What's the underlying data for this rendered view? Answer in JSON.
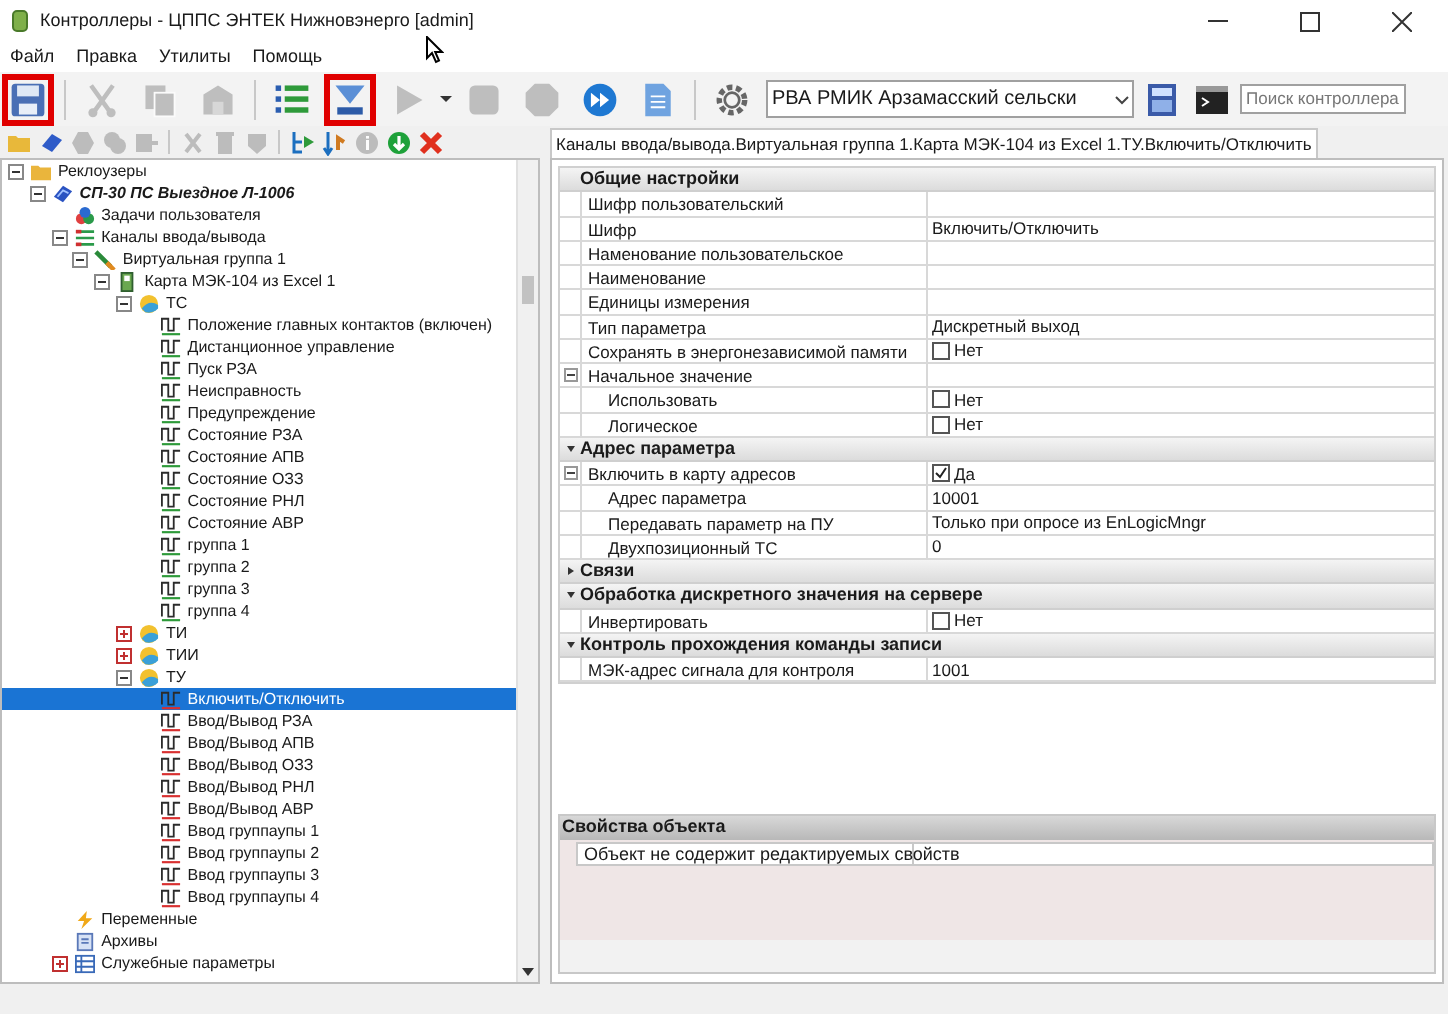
{
  "window": {
    "title": "Контроллеры - ЦППС ЭНТЕК Нижновэнерго [admin]"
  },
  "menu": [
    "Файл",
    "Правка",
    "Утилиты",
    "Помощь"
  ],
  "toolbar": {
    "buttons": [
      {
        "kind": "save",
        "disabled": false,
        "highlighted": true
      },
      {
        "kind": "separator"
      },
      {
        "kind": "cut",
        "disabled": true,
        "highlighted": false
      },
      {
        "kind": "copy",
        "disabled": true,
        "highlighted": false
      },
      {
        "kind": "paste",
        "disabled": true,
        "highlighted": false
      },
      {
        "kind": "separator"
      },
      {
        "kind": "list",
        "disabled": false,
        "highlighted": false
      },
      {
        "kind": "download",
        "disabled": false,
        "highlighted": true
      },
      {
        "kind": "play",
        "disabled": true,
        "highlighted": false
      },
      {
        "kind": "caret"
      },
      {
        "kind": "stop",
        "disabled": true,
        "highlighted": false
      },
      {
        "kind": "blob",
        "disabled": true,
        "highlighted": false
      },
      {
        "kind": "forward",
        "disabled": false,
        "highlighted": false
      },
      {
        "kind": "document",
        "disabled": false,
        "highlighted": false
      },
      {
        "kind": "separator"
      },
      {
        "kind": "gear",
        "disabled": false,
        "highlighted": false
      }
    ],
    "controller_select": {
      "value": "РВА РМИК Арзамасский сельски"
    },
    "extra_buttons": [
      {
        "kind": "calculator"
      },
      {
        "kind": "terminal"
      }
    ],
    "search": {
      "placeholder": "Поиск контроллера"
    }
  },
  "tree_toolbar": [
    {
      "kind": "folder",
      "disabled": false
    },
    {
      "kind": "eraser",
      "disabled": false
    },
    {
      "kind": "hexagon",
      "disabled": true
    },
    {
      "kind": "circles",
      "disabled": true
    },
    {
      "kind": "export",
      "disabled": true
    },
    {
      "kind": "separator"
    },
    {
      "kind": "cut",
      "disabled": true
    },
    {
      "kind": "trash",
      "disabled": true
    },
    {
      "kind": "shield",
      "disabled": true
    },
    {
      "kind": "separator"
    },
    {
      "kind": "tree",
      "disabled": false
    },
    {
      "kind": "sort",
      "disabled": false
    },
    {
      "kind": "info",
      "disabled": true
    },
    {
      "kind": "add",
      "disabled": false
    },
    {
      "kind": "delete",
      "disabled": false
    }
  ],
  "tree": [
    {
      "label": "Реклоузеры",
      "kind": "folder",
      "expanded": true,
      "selected": false,
      "children": [
        {
          "label": "СП-30 ПС Выездное Л-1006",
          "kind": "device",
          "bold": true,
          "expanded": true,
          "selected": false,
          "children": [
            {
              "label": "Задачи пользователя",
              "kind": "tasks",
              "selected": false
            },
            {
              "label": "Каналы ввода/вывода",
              "kind": "channels",
              "expanded": true,
              "selected": false,
              "children": [
                {
                  "label": "Виртуальная группа 1",
                  "kind": "group",
                  "expanded": true,
                  "selected": false,
                  "children": [
                    {
                      "label": "Карта МЭК-104 из Excel 1",
                      "kind": "card",
                      "expanded": true,
                      "selected": false,
                      "children": [
                        {
                          "label": "ТС",
                          "kind": "category",
                          "expanded": true,
                          "selected": false,
                          "children": [
                            {
                              "label": "Положение главных контактов (включен)",
                              "kind": "signal_in",
                              "selected": false
                            },
                            {
                              "label": "Дистанционное управление",
                              "kind": "signal_in",
                              "selected": false
                            },
                            {
                              "label": "Пуск РЗА",
                              "kind": "signal_in",
                              "selected": false
                            },
                            {
                              "label": "Неисправность",
                              "kind": "signal_in",
                              "selected": false
                            },
                            {
                              "label": "Предупреждение",
                              "kind": "signal_in",
                              "selected": false
                            },
                            {
                              "label": "Состояние РЗА",
                              "kind": "signal_in",
                              "selected": false
                            },
                            {
                              "label": "Состояние АПВ",
                              "kind": "signal_in",
                              "selected": false
                            },
                            {
                              "label": "Состояние ОЗЗ",
                              "kind": "signal_in",
                              "selected": false
                            },
                            {
                              "label": "Состояние РНЛ",
                              "kind": "signal_in",
                              "selected": false
                            },
                            {
                              "label": "Состояние АВР",
                              "kind": "signal_in",
                              "selected": false
                            },
                            {
                              "label": "группа 1",
                              "kind": "signal_in",
                              "selected": false
                            },
                            {
                              "label": "группа 2",
                              "kind": "signal_in",
                              "selected": false
                            },
                            {
                              "label": "группа 3",
                              "kind": "signal_in",
                              "selected": false
                            },
                            {
                              "label": "группа 4",
                              "kind": "signal_in",
                              "selected": false
                            }
                          ]
                        },
                        {
                          "label": "ТИ",
                          "kind": "category",
                          "expanded": false,
                          "selected": false
                        },
                        {
                          "label": "ТИИ",
                          "kind": "category",
                          "expanded": false,
                          "selected": false
                        },
                        {
                          "label": "ТУ",
                          "kind": "category",
                          "expanded": true,
                          "selected": false,
                          "children": [
                            {
                              "label": "Включить/Отключить",
                              "kind": "signal_out",
                              "selected": true
                            },
                            {
                              "label": "Ввод/Вывод РЗА",
                              "kind": "signal_out",
                              "selected": false
                            },
                            {
                              "label": "Ввод/Вывод АПВ",
                              "kind": "signal_out",
                              "selected": false
                            },
                            {
                              "label": "Ввод/Вывод ОЗЗ",
                              "kind": "signal_out",
                              "selected": false
                            },
                            {
                              "label": "Ввод/Вывод РНЛ",
                              "kind": "signal_out",
                              "selected": false
                            },
                            {
                              "label": "Ввод/Вывод АВР",
                              "kind": "signal_out",
                              "selected": false
                            },
                            {
                              "label": "Ввод группаупы 1",
                              "kind": "signal_out",
                              "selected": false
                            },
                            {
                              "label": "Ввод группаупы 2",
                              "kind": "signal_out",
                              "selected": false
                            },
                            {
                              "label": "Ввод группаупы 3",
                              "kind": "signal_out",
                              "selected": false
                            },
                            {
                              "label": "Ввод группаупы 4",
                              "kind": "signal_out",
                              "selected": false
                            }
                          ]
                        }
                      ]
                    }
                  ]
                }
              ]
            },
            {
              "label": "Переменные",
              "kind": "variables",
              "selected": false
            },
            {
              "label": "Архивы",
              "kind": "archives",
              "selected": false
            },
            {
              "label": "Служебные параметры",
              "kind": "service",
              "expanded": false,
              "selected": false
            }
          ]
        }
      ]
    }
  ],
  "tab": {
    "label": "Каналы ввода/вывода.Виртуальная группа 1.Карта МЭК-104 из Excel 1.ТУ.Включить/Отключить",
    "selected": true
  },
  "properties": [
    {
      "title": "Общие настройки",
      "rows": [
        {
          "name": "Шифр пользовательский",
          "kind": "text"
        },
        {
          "name": "Шифр",
          "kind": "text",
          "value": "Включить/Отключить"
        },
        {
          "name": "Наменование пользовательское",
          "kind": "text"
        },
        {
          "name": "Наименование",
          "kind": "text"
        },
        {
          "name": "Единицы измерения",
          "kind": "text"
        },
        {
          "name": "Тип параметра",
          "kind": "text",
          "value": "Дискретный выход"
        },
        {
          "name": "Сохранять в энергонезависимой памяти",
          "kind": "check",
          "checked": false,
          "value": "Нет"
        },
        {
          "name": "Начальное значение",
          "kind": "text",
          "expanded": true,
          "children": [
            {
              "name": "Использовать",
              "kind": "check",
              "checked": false,
              "value": "Нет"
            },
            {
              "name": "Логическое",
              "kind": "check",
              "checked": false,
              "value": "Нет"
            }
          ]
        }
      ]
    },
    {
      "title": "Адрес параметра",
      "expanded": true,
      "rows": [
        {
          "name": "Включить в карту адресов",
          "kind": "check",
          "checked": true,
          "value": "Да",
          "expanded": true,
          "children": [
            {
              "name": "Адрес параметра",
              "kind": "text",
              "value": "10001"
            },
            {
              "name": "Передавать параметр на ПУ",
              "kind": "text",
              "value": "Только при опросе из EnLogicMngr"
            },
            {
              "name": "Двухпозиционный ТС",
              "kind": "text",
              "value": "0"
            }
          ]
        }
      ]
    },
    {
      "title": "Связи",
      "expanded": false
    },
    {
      "title": "Обработка дискретного значения на сервере",
      "expanded": true,
      "rows": [
        {
          "name": "Инвертировать",
          "kind": "check",
          "checked": false,
          "value": "Нет"
        }
      ]
    },
    {
      "title": "Контроль прохождения команды записи",
      "expanded": true,
      "rows": [
        {
          "name": "МЭК-адрес сигнала для контроля",
          "kind": "text",
          "value": "1001"
        }
      ]
    }
  ],
  "object_properties": {
    "title": "Свойства объекта",
    "message": "Объект не содержит редактируемых свойств"
  }
}
